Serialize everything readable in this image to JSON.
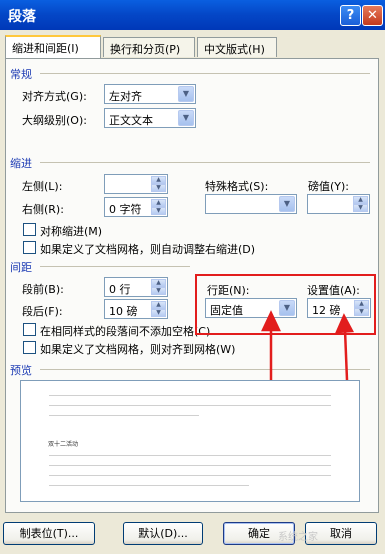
{
  "window": {
    "title": "段落",
    "help_glyph": "?",
    "close_glyph": "✕"
  },
  "tabs": [
    "缩进和间距(I)",
    "换行和分页(P)",
    "中文版式(H)"
  ],
  "general": {
    "heading": "常规",
    "alignment_label": "对齐方式(G):",
    "alignment_value": "左对齐",
    "outline_label": "大纲级别(O):",
    "outline_value": "正文文本"
  },
  "indent": {
    "heading": "缩进",
    "left_label": "左侧(L):",
    "left_value": "",
    "right_label": "右侧(R):",
    "right_value": "0 字符",
    "special_label": "特殊格式(S):",
    "special_value": "",
    "by_label": "磅值(Y):",
    "by_value": "",
    "mirror_label": "对称缩进(M)",
    "autoadjust_label": "如果定义了文档网格，则自动调整右缩进(D)"
  },
  "spacing": {
    "heading": "间距",
    "before_label": "段前(B):",
    "before_value": "0 行",
    "after_label": "段后(F):",
    "after_value": "10 磅",
    "line_label": "行距(N):",
    "line_value": "固定值",
    "at_label": "设置值(A):",
    "at_value": "12 磅",
    "nospace_label": "在相同样式的段落间不添加空格(C)",
    "snap_label": "如果定义了文档网格，则对齐到网格(W)"
  },
  "preview": {
    "heading": "预览",
    "sample_text": "双十二活动"
  },
  "buttons": {
    "tabs": "制表位(T)...",
    "default": "默认(D)...",
    "ok": "确定",
    "cancel": "取消"
  },
  "watermark": "系统之家",
  "colors": {
    "titlebar": "#0446c6",
    "section_heading": "#1e3cb4",
    "annotation": "#e21d1d"
  }
}
